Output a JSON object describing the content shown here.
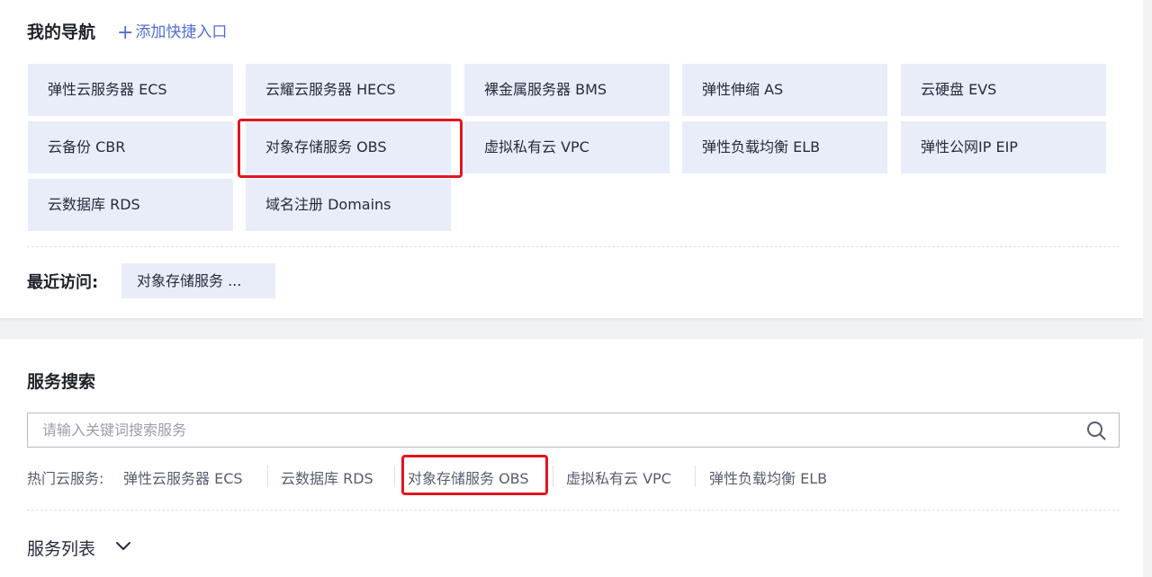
{
  "nav": {
    "title": "我的导航",
    "add_plus": "+",
    "add_label": "添加快捷入口",
    "tiles": [
      "弹性云服务器 ECS",
      "云耀云服务器 HECS",
      "裸金属服务器 BMS",
      "弹性伸缩 AS",
      "云硬盘 EVS",
      "云备份 CBR",
      "对象存储服务 OBS",
      "虚拟私有云 VPC",
      "弹性负载均衡 ELB",
      "弹性公网IP EIP",
      "云数据库 RDS",
      "域名注册 Domains"
    ],
    "highlighted_tile": "对象存储服务 OBS"
  },
  "recent": {
    "label": "最近访问:",
    "items": [
      "对象存储服务 ..."
    ]
  },
  "search": {
    "title": "服务搜索",
    "placeholder": "请输入关键词搜索服务",
    "hot_label": "热门云服务:",
    "hot_items": [
      "弹性云服务器 ECS",
      "云数据库 RDS",
      "对象存储服务 OBS",
      "虚拟私有云 VPC",
      "弹性负载均衡 ELB"
    ],
    "highlighted_hot_item": "对象存储服务 OBS"
  },
  "service_list": {
    "label": "服务列表"
  },
  "icons": {
    "search": "search-icon",
    "chevron": "chevron-down-icon"
  },
  "colors": {
    "accent": "#526ecc",
    "tile_bg": "#e9edfa",
    "highlight": "#e0161f"
  }
}
